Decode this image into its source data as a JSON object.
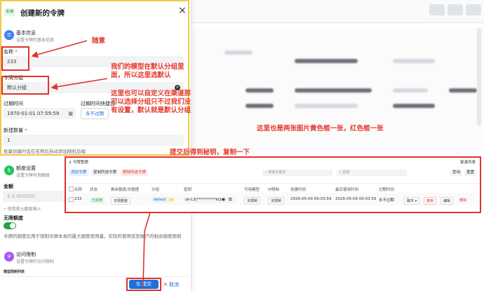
{
  "panel": {
    "new_tag": "新建",
    "title": "创建新的令牌",
    "close": "×",
    "basic": {
      "title": "基本信息",
      "subtitle": "设置令牌的基本信息"
    },
    "name_label": "名称",
    "name_value": "233",
    "group_label": "令牌分组",
    "group_value": "默认分组",
    "expire_label": "过期时间",
    "expire_value": "1970-01-01 07:59:59",
    "quick_label": "过期时间快捷设",
    "quick_btn": "永不过期",
    "qty_label": "新建数量",
    "qty_value": "1",
    "qty_hint": "批量创建时会在名称后自动添加随机后缀",
    "quota": {
      "title": "额度设置",
      "subtitle": "设置令牌可用额度"
    },
    "amount_label": "金额",
    "amount_value": "$ 0.000000",
    "amount_hint": "• 使用美元额度输入",
    "unlimited_label": "无限额度",
    "unlimited_hint": "令牌的额度仅用于限制令牌本身的最大额度使用量，实际的使用受到账户的剩余额度限制",
    "access": {
      "title": "访问限制",
      "subtitle": "设置令牌的访问限制"
    },
    "footer_note": "模型限制列表",
    "submit": "提交",
    "cancel": "取消"
  },
  "annotations": {
    "a1": "随意",
    "a2": "我们的模型在默认分组里面，所以这里选默认",
    "a3": "这里也可以自定义在渠道那可以选择分组只不过我们没有设置，默认就是默认分组",
    "a4": "这里也是两张图片黄色框一张，红色框一张",
    "a5": "提交后得到秘钥，复制一下"
  },
  "token": {
    "title": "令牌管理",
    "corner_btn": "紧凑列表",
    "add_btn": "添加令牌",
    "copy_btn": "复制所选令牌",
    "del_btn": "删除所选令牌",
    "search_placeholder": "搜索关键字",
    "key_placeholder": "密钥",
    "query_btn": "查询",
    "reset_btn": "重置",
    "headers": [
      "名称",
      "状态",
      "剩余额度/总额度",
      "分组",
      "密钥",
      "可用模型",
      "IP限制",
      "创建时间",
      "最后使用时间",
      "过期时间"
    ],
    "row": {
      "name": "233",
      "status": "已启用",
      "quota": "无限额度",
      "group": "default",
      "group_extra": "1x",
      "key": "sk-L3j**********kQx",
      "models": "无限制",
      "ip": "无限制",
      "created": "2026-05-09 00:03:59",
      "last_used": "2026-05-09 00:03:59",
      "expire": "永不过期",
      "chat_btn": "聊天",
      "disable_btn": "禁用",
      "edit_btn": "编辑",
      "delete_btn": "删除"
    }
  }
}
